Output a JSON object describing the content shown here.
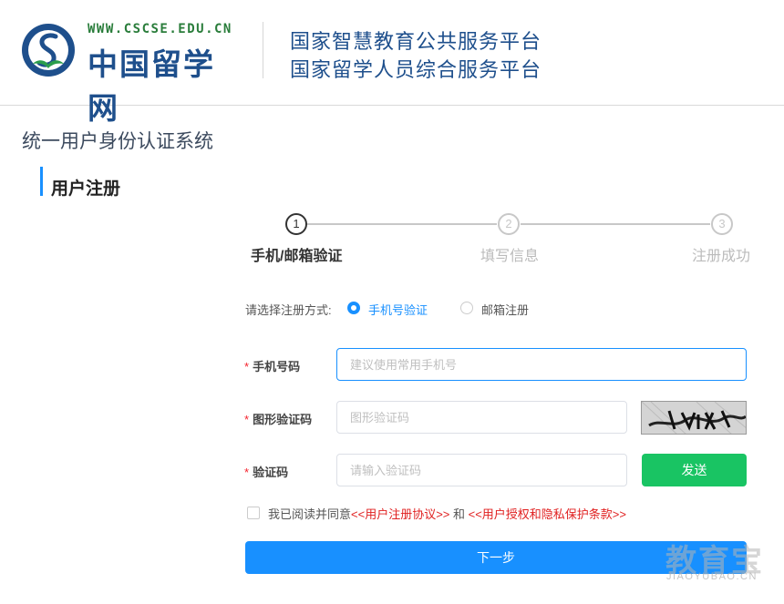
{
  "header": {
    "logo_url": "WWW.CSCSE.EDU.CN",
    "logo_name": "中国留学网",
    "platform_line1": "国家智慧教育公共服务平台",
    "platform_line2": "国家留学人员综合服务平台"
  },
  "system_title": "统一用户身份认证系统",
  "section_title": "用户注册",
  "steps": [
    {
      "number": "1",
      "label": "手机/邮箱验证",
      "active": true
    },
    {
      "number": "2",
      "label": "填写信息",
      "active": false
    },
    {
      "number": "3",
      "label": "注册成功",
      "active": false
    }
  ],
  "method": {
    "label": "请选择注册方式:",
    "options": [
      {
        "label": "手机号验证",
        "checked": true
      },
      {
        "label": "邮箱注册",
        "checked": false
      }
    ]
  },
  "form": {
    "phone": {
      "required_mark": "*",
      "label": "手机号码",
      "placeholder": "建议使用常用手机号",
      "value": ""
    },
    "image_code": {
      "required_mark": "*",
      "label": "图形验证码",
      "placeholder": "图形验证码",
      "value": ""
    },
    "sms_code": {
      "required_mark": "*",
      "label": "验证码",
      "placeholder": "请输入验证码",
      "value": ""
    },
    "send_label": "发送"
  },
  "agreement": {
    "prefix": "我已阅读并同意",
    "link1": "<<用户注册协议>>",
    "and": " 和 ",
    "link2": "<<用户授权和隐私保护条款>>"
  },
  "next_label": "下一步",
  "watermark": {
    "main": "教育宝",
    "sub": "JIAOYUBAO.CN"
  },
  "colors": {
    "primary": "#1890ff",
    "send": "#19c463",
    "link": "#e02020",
    "brand": "#1e4f8c"
  }
}
